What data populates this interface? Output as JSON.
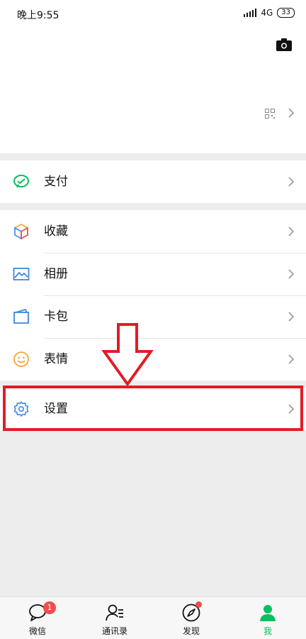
{
  "status_bar": {
    "time": "晚上9:55",
    "network": "4G",
    "battery": "33"
  },
  "menu": {
    "pay": "支付",
    "favorites": "收藏",
    "album": "相册",
    "cards": "卡包",
    "stickers": "表情",
    "settings": "设置"
  },
  "tabbar": {
    "chats": {
      "label": "微信",
      "badge": "1"
    },
    "contacts": {
      "label": "通讯录"
    },
    "discover": {
      "label": "发现"
    },
    "me": {
      "label": "我"
    }
  },
  "colors": {
    "accent": "#07c160",
    "highlight": "#e31c24",
    "badge": "#f04c4c"
  },
  "icons": {
    "pay": "wechat-pay-icon",
    "favorites": "cube-icon",
    "album": "image-icon",
    "cards": "wallet-icon",
    "stickers": "smile-icon",
    "settings": "gear-icon"
  }
}
